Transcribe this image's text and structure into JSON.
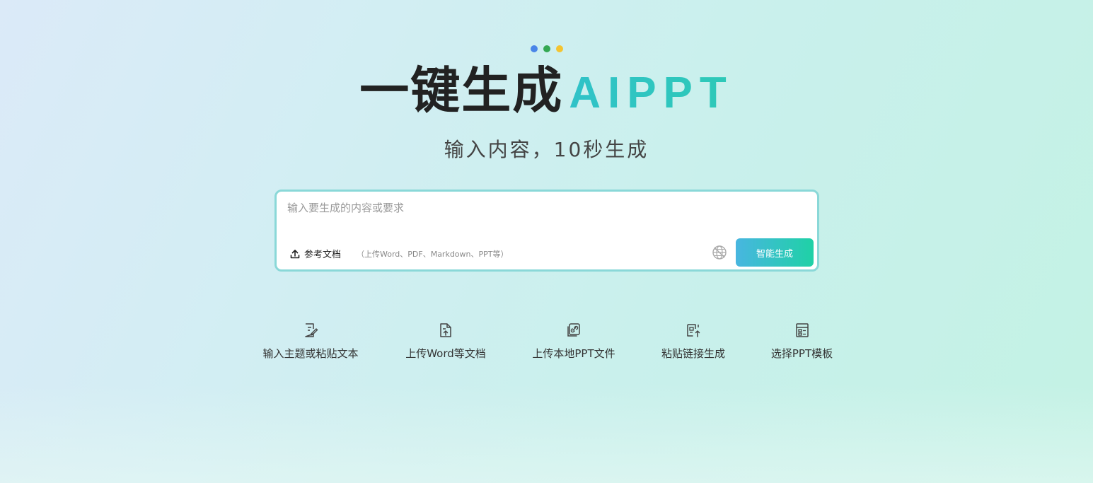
{
  "colors": {
    "dot_blue": "#4a86e8",
    "dot_green": "#34a853",
    "dot_yellow": "#f4c430",
    "accent": "#2ec4c0",
    "button_gradient_start": "#48b6e0",
    "button_gradient_end": "#1fd1a6"
  },
  "hero": {
    "title_main": "一键生成",
    "title_accent": "AIPPT",
    "subtitle": "输入内容，10秒生成"
  },
  "input": {
    "placeholder": "输入要生成的内容或要求",
    "value": "",
    "ref_doc_label": "参考文档",
    "ref_doc_icon": "upload-icon",
    "ref_hint": "（上传Word、PDF、Markdown、PPT等）",
    "language_icon": "globe-icon",
    "generate_label": "智能生成"
  },
  "features": [
    {
      "label": "输入主题或粘贴文本",
      "icon": "edit-document-icon"
    },
    {
      "label": "上传Word等文档",
      "icon": "upload-document-icon"
    },
    {
      "label": "上传本地PPT文件",
      "icon": "link-files-icon"
    },
    {
      "label": "粘贴链接生成",
      "icon": "paste-link-icon"
    },
    {
      "label": "选择PPT模板",
      "icon": "template-layout-icon"
    }
  ]
}
